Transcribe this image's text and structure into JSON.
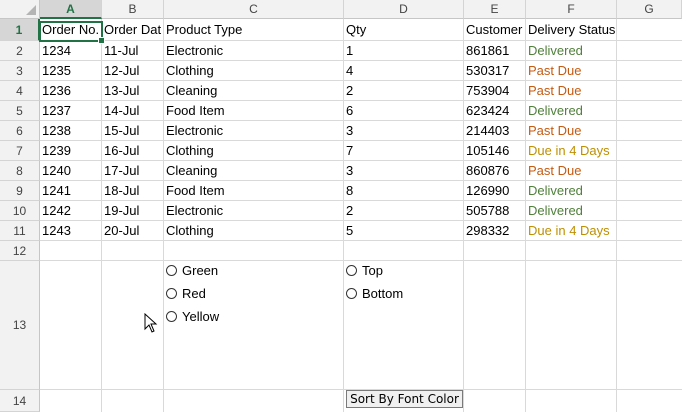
{
  "columns": [
    "A",
    "B",
    "C",
    "D",
    "E",
    "F",
    "G"
  ],
  "rows": [
    "1",
    "2",
    "3",
    "4",
    "5",
    "6",
    "7",
    "8",
    "9",
    "10",
    "11",
    "12",
    "13",
    "14"
  ],
  "headers": [
    "Order No.",
    "Order Dat",
    "Product Type",
    "Qty",
    "Customer",
    "Delivery Status"
  ],
  "data": [
    [
      "1234",
      "11-Jul",
      "Electronic",
      "1",
      "861861",
      "Delivered"
    ],
    [
      "1235",
      "12-Jul",
      "Clothing",
      "4",
      "530317",
      "Past Due"
    ],
    [
      "1236",
      "13-Jul",
      "Cleaning",
      "2",
      "753904",
      "Past Due"
    ],
    [
      "1237",
      "14-Jul",
      "Food Item",
      "6",
      "623424",
      "Delivered"
    ],
    [
      "1238",
      "15-Jul",
      "Electronic",
      "3",
      "214403",
      "Past Due"
    ],
    [
      "1239",
      "16-Jul",
      "Clothing",
      "7",
      "105146",
      "Due in 4 Days"
    ],
    [
      "1240",
      "17-Jul",
      "Cleaning",
      "3",
      "860876",
      "Past Due"
    ],
    [
      "1241",
      "18-Jul",
      "Food Item",
      "8",
      "126990",
      "Delivered"
    ],
    [
      "1242",
      "19-Jul",
      "Electronic",
      "2",
      "505788",
      "Delivered"
    ],
    [
      "1243",
      "20-Jul",
      "Clothing",
      "5",
      "298332",
      "Due in 4 Days"
    ]
  ],
  "status_colors": {
    "Delivered": "#4f7f3a",
    "Past Due": "#c55a11",
    "Due in 4 Days": "#bf8f00"
  },
  "color_options": [
    "Green",
    "Red",
    "Yellow"
  ],
  "position_options": [
    "Top",
    "Bottom"
  ],
  "sort_button_label": "Sort By Font Color",
  "active_cell": "A1"
}
